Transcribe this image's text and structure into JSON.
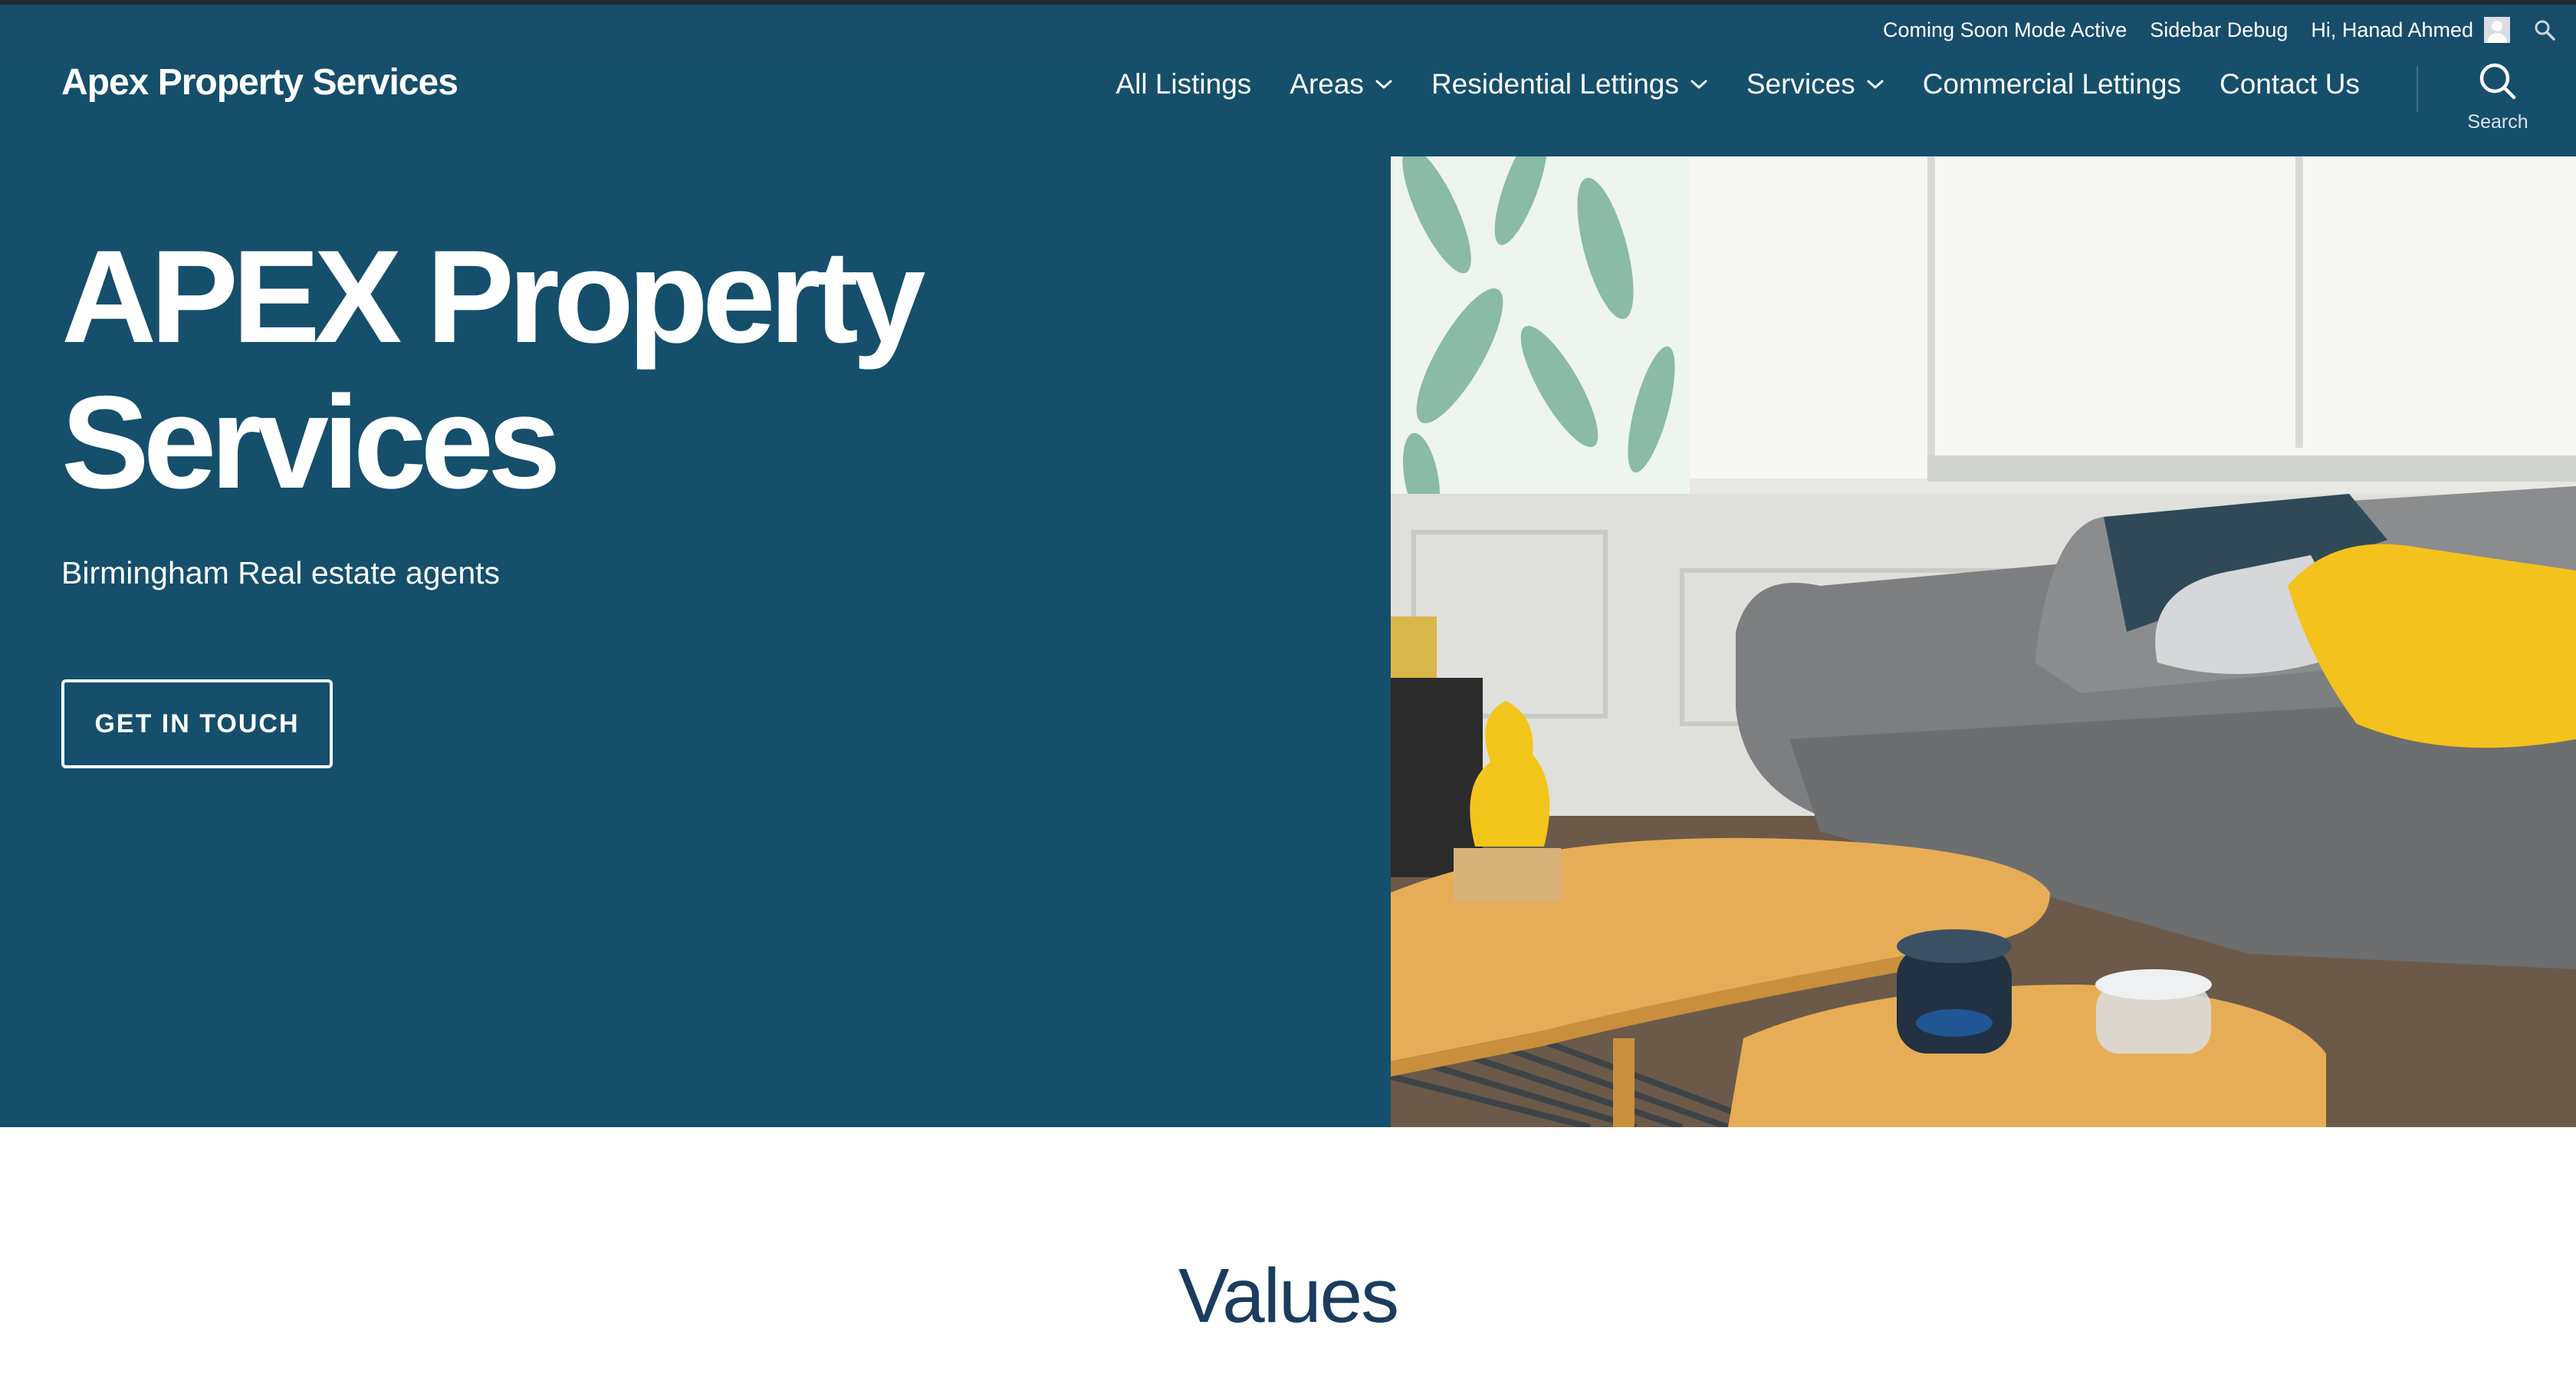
{
  "admin_bar": {
    "coming_soon": "Coming Soon Mode Active",
    "sidebar_debug": "Sidebar Debug",
    "greeting": "Hi, Hanad Ahmed"
  },
  "header": {
    "site_title": "Apex Property Services",
    "nav": [
      {
        "label": "All Listings",
        "has_dropdown": false
      },
      {
        "label": "Areas",
        "has_dropdown": true
      },
      {
        "label": "Residential Lettings",
        "has_dropdown": true
      },
      {
        "label": "Services",
        "has_dropdown": true
      },
      {
        "label": "Commercial Lettings",
        "has_dropdown": false
      },
      {
        "label": "Contact Us",
        "has_dropdown": false
      }
    ],
    "search_label": "Search"
  },
  "hero": {
    "title_line1": "APEX Property",
    "title_line2": "Services",
    "subtitle": "Birmingham Real estate agents",
    "cta": "GET IN TOUCH",
    "image_alt": "living-room-photo"
  },
  "values": {
    "heading": "Values"
  },
  "colors": {
    "header_bg": "#154f6b",
    "hero_bg": "#154f6b",
    "heading_text": "#1a3c5e",
    "accent_yellow": "#f4c21c"
  }
}
